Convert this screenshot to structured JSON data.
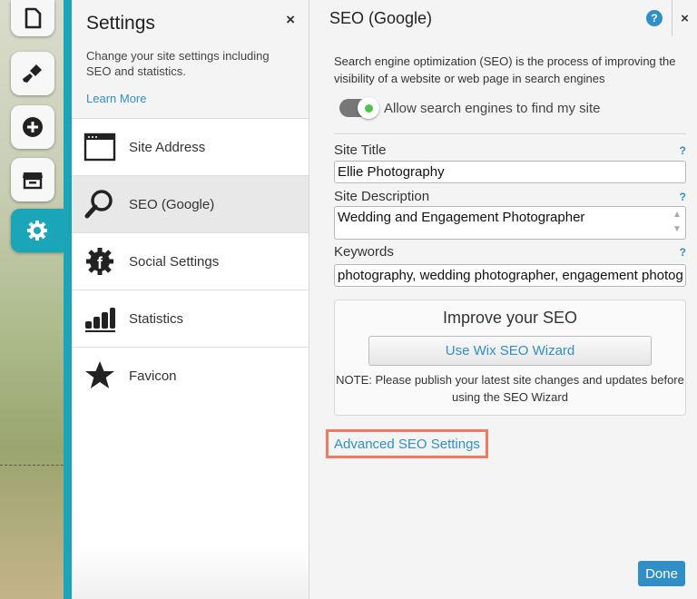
{
  "settings": {
    "title": "Settings",
    "close": "×",
    "description": "Change your site settings including SEO and statistics.",
    "learn_more": "Learn More",
    "menu": [
      {
        "label": "Site Address",
        "icon": "browser-window-icon"
      },
      {
        "label": "SEO (Google)",
        "icon": "magnifier-icon"
      },
      {
        "label": "Social Settings",
        "icon": "social-gear-icon"
      },
      {
        "label": "Statistics",
        "icon": "bar-chart-icon"
      },
      {
        "label": "Favicon",
        "icon": "star-icon"
      }
    ],
    "selected_index": 1
  },
  "seo": {
    "title": "SEO (Google)",
    "help": "?",
    "close": "×",
    "intro": "Search engine optimization (SEO) is the process of improving the visibility of a website or web page in search engines",
    "toggle_label": "Allow search engines to find my site",
    "toggle_on": true,
    "site_title_label": "Site Title",
    "site_title_value": "Ellie Photography",
    "site_description_label": "Site Description",
    "site_description_value": "Wedding and Engagement Photographer",
    "keywords_label": "Keywords",
    "keywords_value": "photography, wedding photographer, engagement photog",
    "field_help": "?",
    "improve_title": "Improve your SEO",
    "wizard_button": "Use Wix SEO Wizard",
    "note": "NOTE: Please publish your latest site changes and updates before using the SEO Wizard",
    "advanced_link": "Advanced SEO Settings",
    "done_button": "Done"
  },
  "toolbar": {
    "items": [
      "pages-icon",
      "design-brush-icon",
      "add-plus-icon",
      "app-market-store-icon",
      "settings-gear-icon"
    ],
    "active": "settings-gear-icon"
  },
  "colors": {
    "accent": "#1aa5b8",
    "link": "#2f8fc6",
    "highlight": "#f07b63",
    "toggle_on": "#4fc24a"
  }
}
